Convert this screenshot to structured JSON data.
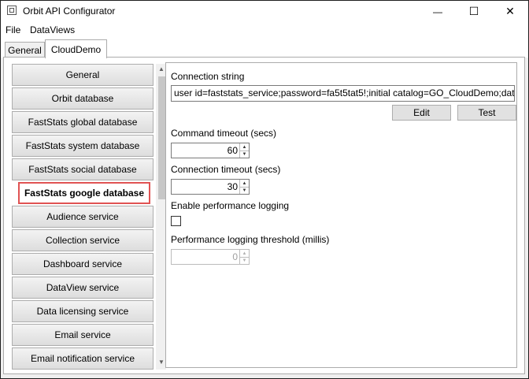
{
  "window": {
    "title": "Orbit API Configurator",
    "minimize_label": "—",
    "maximize_label": "☐",
    "close_label": "✕"
  },
  "menu": {
    "items": [
      {
        "label": "File"
      },
      {
        "label": "DataViews"
      }
    ]
  },
  "tabs": [
    {
      "label": "General",
      "active": false
    },
    {
      "label": "CloudDemo",
      "active": true
    }
  ],
  "sidebar": {
    "items": [
      {
        "label": "General"
      },
      {
        "label": "Orbit database"
      },
      {
        "label": "FastStats global database"
      },
      {
        "label": "FastStats system database"
      },
      {
        "label": "FastStats social database"
      },
      {
        "label": "FastStats google database",
        "selected": true
      },
      {
        "label": "Audience service"
      },
      {
        "label": "Collection service"
      },
      {
        "label": "Dashboard service"
      },
      {
        "label": "DataView service"
      },
      {
        "label": "Data licensing service"
      },
      {
        "label": "Email service"
      },
      {
        "label": "Email notification service"
      }
    ],
    "scroll_up_icon": "▲",
    "scroll_down_icon": "▼"
  },
  "form": {
    "connection_string_label": "Connection string",
    "connection_string_value": "user id=faststats_service;password=fa5t5tat5!;initial catalog=GO_CloudDemo;data",
    "edit_button": "Edit",
    "test_button": "Test",
    "command_timeout_label": "Command timeout (secs)",
    "command_timeout_value": "60",
    "connection_timeout_label": "Connection timeout (secs)",
    "connection_timeout_value": "30",
    "perf_logging_label": "Enable performance logging",
    "perf_logging_checked": false,
    "perf_threshold_label": "Performance logging threshold (millis)",
    "perf_threshold_value": "0"
  },
  "colors": {
    "highlight_border": "#e05353",
    "scroll_thumb": "#c7c7c7"
  }
}
